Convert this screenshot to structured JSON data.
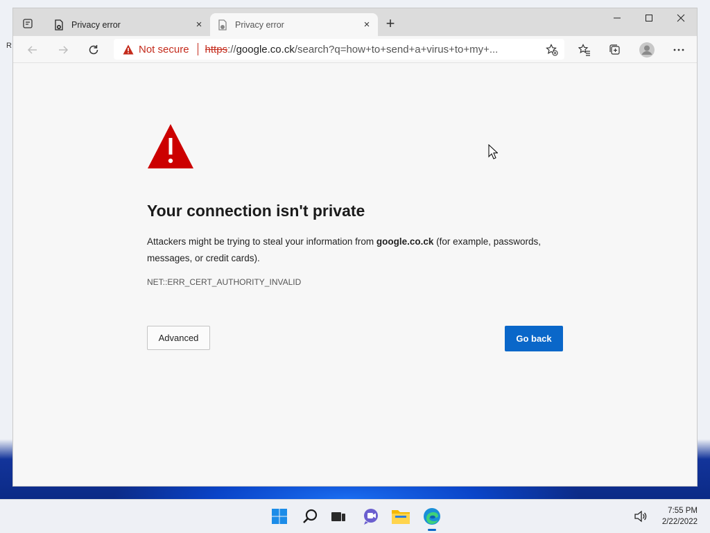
{
  "desktop": {
    "edge_letter": "R"
  },
  "browser": {
    "tabs": [
      {
        "title": "Privacy error",
        "close": "×"
      },
      {
        "title": "Privacy error",
        "close": "×"
      }
    ],
    "new_tab": "+",
    "address": {
      "security_label": "Not secure",
      "url_scheme": "https",
      "url_sep": "://",
      "url_host": "google.co.ck",
      "url_rest": "/search?q=how+to+send+a+virus+to+my+..."
    }
  },
  "page": {
    "heading": "Your connection isn't private",
    "desc_before": "Attackers might be trying to steal your information from ",
    "desc_host": "google.co.ck",
    "desc_after": " (for example, passwords, messages, or credit cards).",
    "error_code": "NET::ERR_CERT_AUTHORITY_INVALID",
    "advanced_label": "Advanced",
    "go_back_label": "Go back"
  },
  "taskbar": {
    "time": "7:55 PM",
    "date": "2/22/2022"
  },
  "colors": {
    "accent": "#0a67c9",
    "danger": "#c42b1c",
    "warning_triangle": "#cc0000"
  }
}
